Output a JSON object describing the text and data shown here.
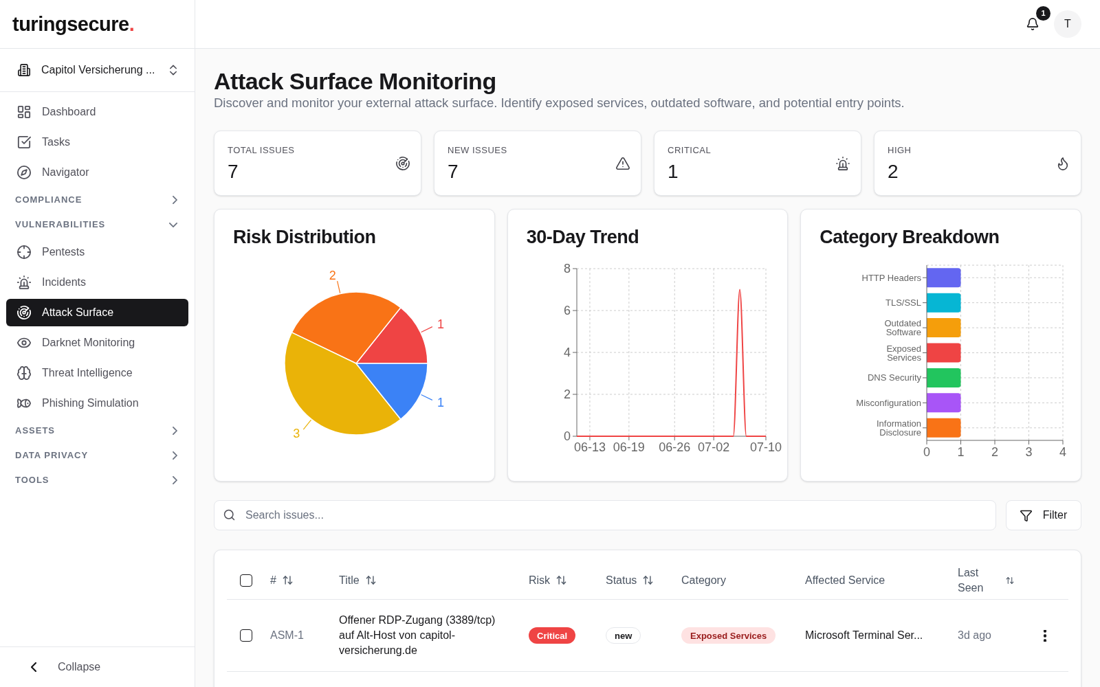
{
  "logo": {
    "text": "turingsecure",
    "accent": "."
  },
  "header": {
    "notifications": {
      "count": "1"
    },
    "avatar": {
      "initial": "T"
    }
  },
  "sidebar": {
    "organization": {
      "name": "Capitol Versicherung ..."
    },
    "items": [
      {
        "kind": "link",
        "label": "Dashboard",
        "selected": false
      },
      {
        "kind": "link",
        "label": "Tasks",
        "selected": false
      },
      {
        "kind": "link",
        "label": "Navigator",
        "selected": false
      },
      {
        "kind": "section",
        "label": "COMPLIANCE",
        "expanded": false
      },
      {
        "kind": "section",
        "label": "VULNERABILITIES",
        "expanded": true,
        "children": [
          {
            "kind": "link",
            "label": "Pentests",
            "selected": false
          },
          {
            "kind": "link",
            "label": "Incidents",
            "selected": false
          },
          {
            "kind": "link",
            "label": "Attack Surface",
            "selected": true
          },
          {
            "kind": "link",
            "label": "Darknet Monitoring",
            "selected": false
          },
          {
            "kind": "link",
            "label": "Threat Intelligence",
            "selected": false
          },
          {
            "kind": "link",
            "label": "Phishing Simulation",
            "selected": false
          }
        ]
      },
      {
        "kind": "section",
        "label": "ASSETS",
        "expanded": false
      },
      {
        "kind": "section",
        "label": "DATA PRIVACY",
        "expanded": false
      },
      {
        "kind": "section",
        "label": "TOOLS",
        "expanded": false
      }
    ],
    "collapse": {
      "label": "Collapse"
    }
  },
  "page": {
    "title": "Attack Surface Monitoring",
    "subtitle": "Discover and monitor your external attack surface. Identify exposed services, outdated software, and potential entry points."
  },
  "stats": [
    {
      "label": "TOTAL ISSUES",
      "value": "7"
    },
    {
      "label": "NEW ISSUES",
      "value": "7"
    },
    {
      "label": "CRITICAL",
      "value": "1"
    },
    {
      "label": "HIGH",
      "value": "2"
    }
  ],
  "charts": [
    {
      "chart_data": {
        "type": "pie",
        "title": "Risk Distribution",
        "values": [
          1,
          2,
          3,
          1
        ],
        "colors": [
          "#ef4444",
          "#f97316",
          "#eab308",
          "#3b82f6"
        ],
        "data_labels": true
      }
    },
    {
      "chart_data": {
        "type": "line",
        "title": "30-Day Trend",
        "categories": [
          null,
          null,
          "06-13",
          null,
          null,
          null,
          null,
          null,
          "06-19",
          null,
          null,
          null,
          null,
          null,
          null,
          "06-26",
          null,
          null,
          null,
          null,
          null,
          "07-02",
          null,
          null,
          null,
          null,
          null,
          null,
          null,
          "07-10"
        ],
        "series": [
          {
            "color": "#ef4444",
            "values": [
              0,
              0,
              0,
              0,
              0,
              0,
              0,
              0,
              0,
              0,
              0,
              0,
              0,
              0,
              0,
              0,
              0,
              0,
              0,
              0,
              0,
              0,
              0,
              0,
              0,
              7,
              0,
              0,
              0,
              0
            ]
          }
        ],
        "ylim": [
          0,
          8
        ],
        "yticks": [
          0,
          2,
          4,
          6,
          8
        ],
        "grid": true
      }
    },
    {
      "chart_data": {
        "type": "bar",
        "title": "Category Breakdown",
        "orientation": "horizontal",
        "categories": [
          "HTTP Headers",
          "TLS/SSL",
          "Outdated Software",
          "Exposed Services",
          "DNS Security",
          "Misconfiguration",
          "Information Disclosure"
        ],
        "values": [
          1,
          1,
          1,
          1,
          1,
          1,
          1
        ],
        "colors": [
          "#6366f1",
          "#06b6d4",
          "#f59e0b",
          "#ef4444",
          "#22c55e",
          "#a855f7",
          "#f97316"
        ],
        "xlim": [
          0,
          4
        ],
        "xticks": [
          0,
          1,
          2,
          3,
          4
        ],
        "grid": true
      }
    }
  ],
  "search": {
    "placeholder": "Search issues..."
  },
  "filter_button": {
    "label": "Filter"
  },
  "table": {
    "select_all": {
      "checked": false
    },
    "columns": [
      {
        "label": "#",
        "sortable": true
      },
      {
        "label": "Title",
        "sortable": true
      },
      {
        "label": "Risk",
        "sortable": true
      },
      {
        "label": "Status",
        "sortable": true
      },
      {
        "label": "Category",
        "sortable": false
      },
      {
        "label": "Affected Service",
        "sortable": false
      },
      {
        "label": "Last Seen",
        "sortable": true
      }
    ],
    "rows": [
      {
        "checked": false,
        "id": "ASM-1",
        "title": "Offener RDP-Zugang (3389/tcp) auf Alt-Host von capitol-versicherung.de",
        "risk": {
          "label": "Critical",
          "color": "#ef4444"
        },
        "status": "new",
        "category": {
          "label": "Exposed Services",
          "color": "#fee2e2"
        },
        "service": "Microsoft Terminal Ser...",
        "last_seen": "3d ago"
      }
    ]
  }
}
